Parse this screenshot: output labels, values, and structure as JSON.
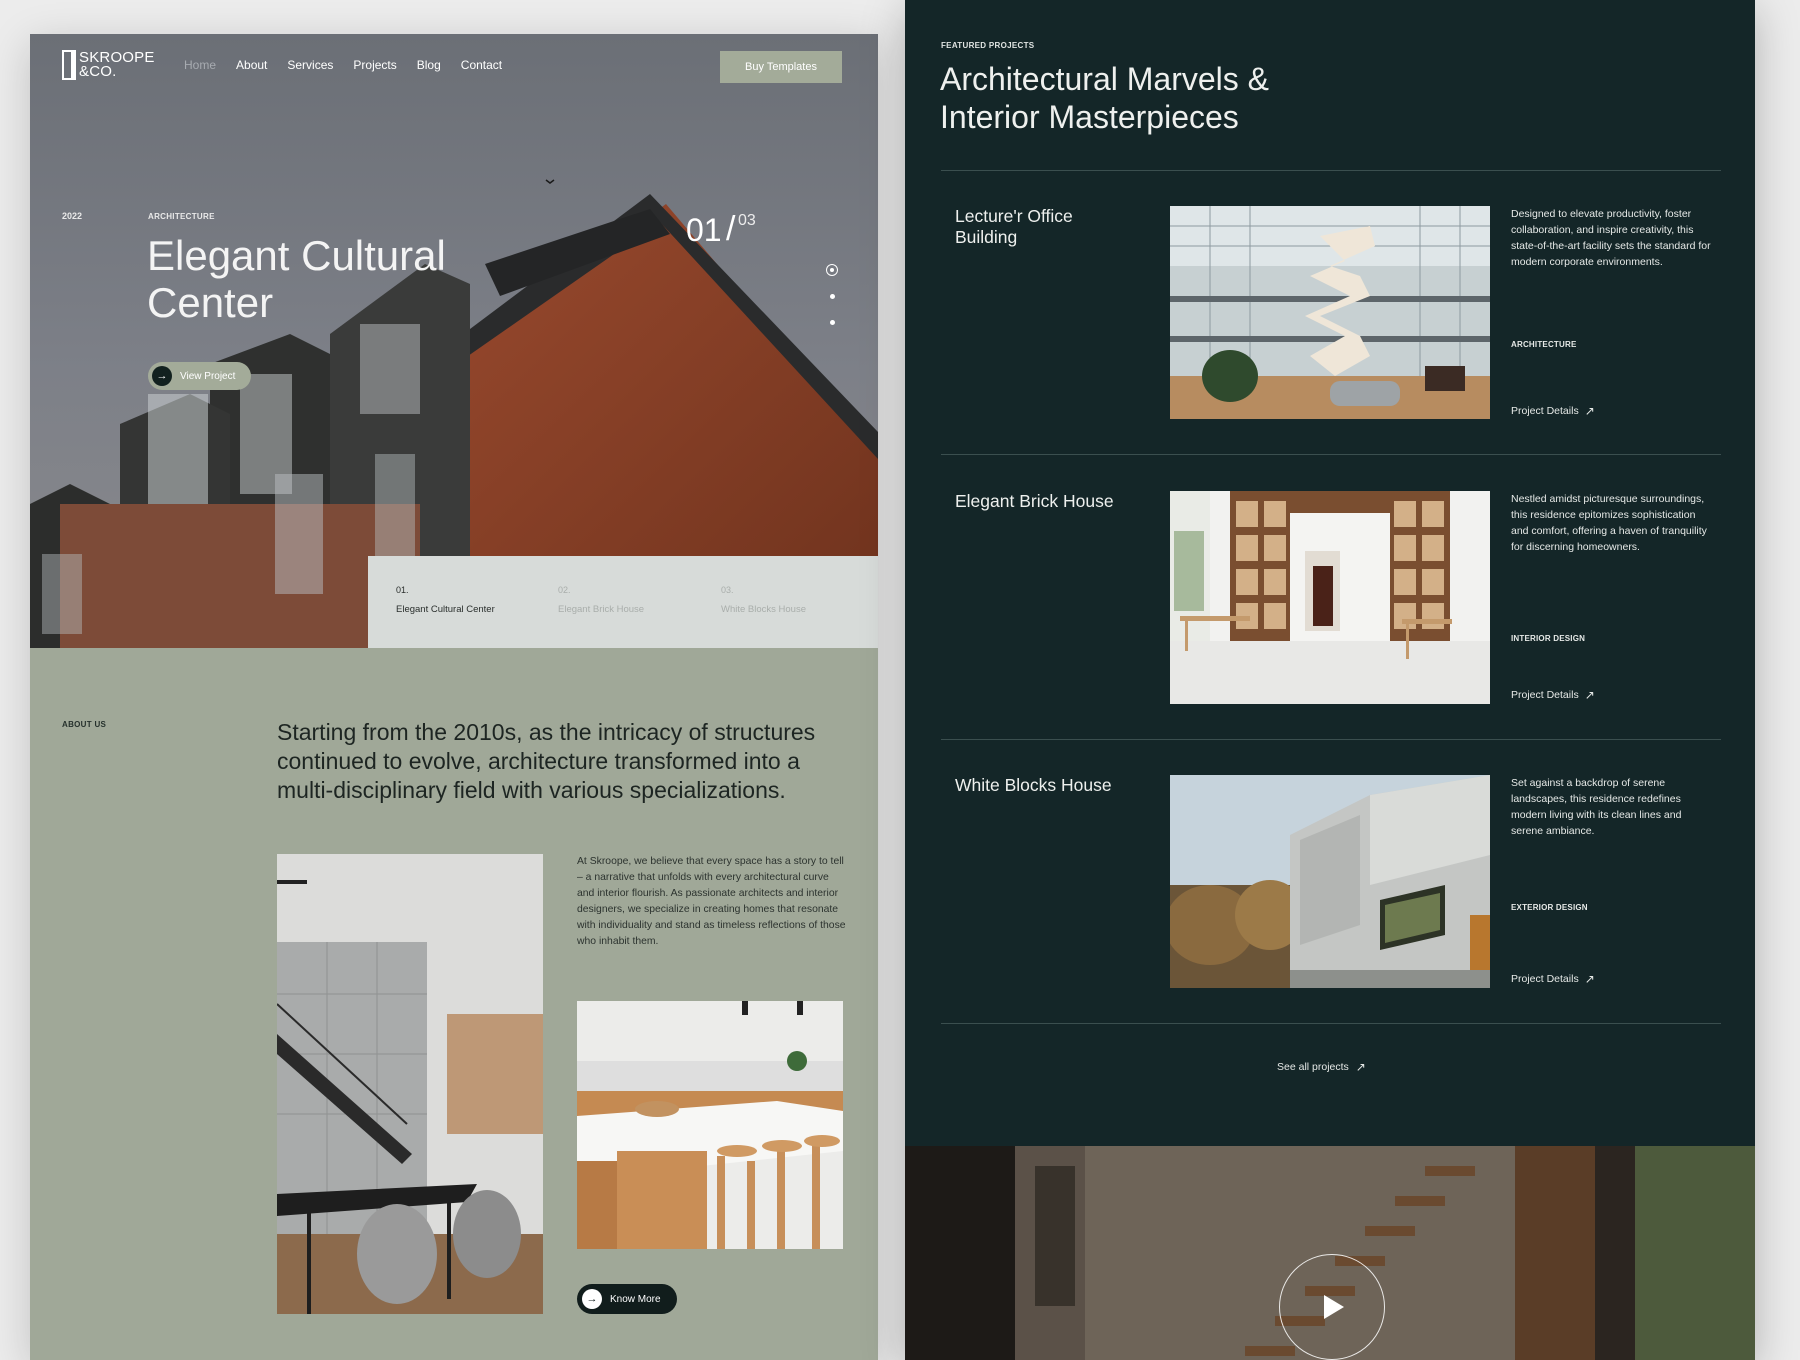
{
  "nav": {
    "logo_line1": "SKROOPE",
    "logo_line2": "&CO.",
    "links": [
      "Home",
      "About",
      "Services",
      "Projects",
      "Blog",
      "Contact"
    ],
    "cta": "Buy Templates"
  },
  "hero": {
    "year": "2022",
    "category": "ARCHITECTURE",
    "title": "Elegant Cultural Center",
    "button": "View Project",
    "slide_current": "01",
    "slide_separator": "/",
    "slide_total": "03",
    "tabs": [
      {
        "num": "01.",
        "label": "Elegant Cultural Center"
      },
      {
        "num": "02.",
        "label": "Elegant Brick House"
      },
      {
        "num": "03.",
        "label": "White Blocks House"
      }
    ]
  },
  "about": {
    "label": "ABOUT US",
    "heading": "Starting from the 2010s, as the intricacy of structures continued to evolve, architecture transformed into a multi-disciplinary field with various specializations.",
    "paragraph": "At Skroope, we believe that every space has a story to tell – a narrative that unfolds with every architectural curve and interior flourish. As passionate architects and interior designers, we specialize in creating homes that resonate with individuality and stand as timeless reflections of those who inhabit them.",
    "button": "Know More"
  },
  "featured": {
    "label": "FEATURED PROJECTS",
    "title": "Architectural Marvels & Interior Masterpieces",
    "details_label": "Project Details",
    "see_all": "See all projects",
    "projects": [
      {
        "name": "Lecture'r Office Building",
        "description": "Designed to elevate productivity, foster collaboration, and inspire creativity, this state-of-the-art facility sets the standard for modern corporate environments.",
        "category": "ARCHITECTURE"
      },
      {
        "name": "Elegant Brick House",
        "description": "Nestled amidst picturesque surroundings, this residence epitomizes sophistication and comfort, offering a haven of tranquility for discerning homeowners.",
        "category": "INTERIOR DESIGN"
      },
      {
        "name": "White Blocks House",
        "description": "Set against a backdrop of serene landscapes, this residence redefines modern living with its clean lines and serene ambiance.",
        "category": "EXTERIOR DESIGN"
      }
    ]
  },
  "colors": {
    "sage": "#a0a898",
    "dark_teal": "#142628",
    "brick": "#8a3f26",
    "light_tab": "#d7dbd9"
  },
  "icons": [
    "logo-icon",
    "arrow-right-icon",
    "arrow-up-right-icon",
    "play-icon",
    "slider-dot-icon"
  ]
}
